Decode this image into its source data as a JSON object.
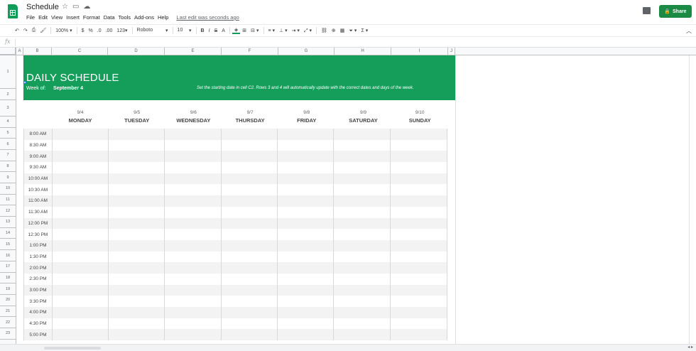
{
  "app": {
    "doc_title": "Schedule",
    "menu": [
      "File",
      "Edit",
      "View",
      "Insert",
      "Format",
      "Data",
      "Tools",
      "Add-ons",
      "Help"
    ],
    "last_edit": "Last edit was seconds ago",
    "share_label": "Share",
    "title_icons": [
      "star-icon",
      "folder-icon",
      "cloud-icon"
    ]
  },
  "toolbar": {
    "zoom": "100%",
    "currency": "$",
    "percent": "%",
    "dec_decrease": ".0",
    "dec_increase": ".00",
    "more_formats": "123",
    "font": "Roboto",
    "font_size": "10",
    "bold": "B",
    "italic": "I",
    "strike": "S",
    "text_color": "A"
  },
  "formula_bar": {
    "fx": "fx"
  },
  "columns": [
    "A",
    "B",
    "C",
    "D",
    "E",
    "F",
    "G",
    "H",
    "I",
    "J"
  ],
  "rows": [
    "1",
    "2",
    "3",
    "4",
    "5",
    "6",
    "7",
    "8",
    "9",
    "10",
    "11",
    "12",
    "13",
    "14",
    "15",
    "16",
    "17",
    "18",
    "19",
    "20",
    "21",
    "22",
    "23"
  ],
  "sheet": {
    "title": "DAILY SCHEDULE",
    "week_of_label": "Week of:",
    "week_of_date": "September 4",
    "note": "Set the starting date in cell C2. Rows 3 and 4 will automatically update with the correct dates and days of the week.",
    "banner_color": "#149e5a",
    "days": [
      {
        "date": "9/4",
        "name": "MONDAY"
      },
      {
        "date": "9/5",
        "name": "TUESDAY"
      },
      {
        "date": "9/6",
        "name": "WEDNESDAY"
      },
      {
        "date": "9/7",
        "name": "THURSDAY"
      },
      {
        "date": "9/8",
        "name": "FRIDAY"
      },
      {
        "date": "9/9",
        "name": "SATURDAY"
      },
      {
        "date": "9/10",
        "name": "SUNDAY"
      }
    ],
    "times": [
      "8:00 AM",
      "8:30 AM",
      "9:00 AM",
      "9:30 AM",
      "10:00 AM",
      "10:30 AM",
      "11:00 AM",
      "11:30 AM",
      "12:00 PM",
      "12:30 PM",
      "1:00 PM",
      "1:30 PM",
      "2:00 PM",
      "2:30 PM",
      "3:00 PM",
      "3:30 PM",
      "4:00 PM",
      "4:30 PM",
      "5:00 PM"
    ]
  }
}
